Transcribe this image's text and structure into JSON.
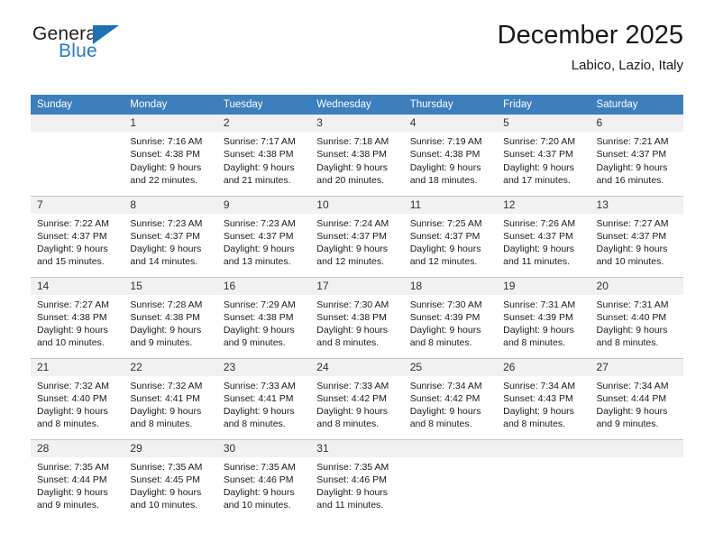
{
  "logo": {
    "name_top": "General",
    "name_bottom": "Blue",
    "flag_icon": "blue-flag-triangle",
    "color_blue": "#1f7ec4",
    "color_dark": "#231f20"
  },
  "header": {
    "title": "December 2025",
    "subtitle": "Labico, Lazio, Italy"
  },
  "theme": {
    "header_bar": "#3d7ebd",
    "daynum_band": "#f1f1f1",
    "grid_line": "#b9c8d6"
  },
  "weekday_headers": [
    "Sunday",
    "Monday",
    "Tuesday",
    "Wednesday",
    "Thursday",
    "Friday",
    "Saturday"
  ],
  "weeks": [
    [
      {
        "day": "",
        "lines": []
      },
      {
        "day": "1",
        "lines": [
          "Sunrise: 7:16 AM",
          "Sunset: 4:38 PM",
          "Daylight: 9 hours",
          "and 22 minutes."
        ]
      },
      {
        "day": "2",
        "lines": [
          "Sunrise: 7:17 AM",
          "Sunset: 4:38 PM",
          "Daylight: 9 hours",
          "and 21 minutes."
        ]
      },
      {
        "day": "3",
        "lines": [
          "Sunrise: 7:18 AM",
          "Sunset: 4:38 PM",
          "Daylight: 9 hours",
          "and 20 minutes."
        ]
      },
      {
        "day": "4",
        "lines": [
          "Sunrise: 7:19 AM",
          "Sunset: 4:38 PM",
          "Daylight: 9 hours",
          "and 18 minutes."
        ]
      },
      {
        "day": "5",
        "lines": [
          "Sunrise: 7:20 AM",
          "Sunset: 4:37 PM",
          "Daylight: 9 hours",
          "and 17 minutes."
        ]
      },
      {
        "day": "6",
        "lines": [
          "Sunrise: 7:21 AM",
          "Sunset: 4:37 PM",
          "Daylight: 9 hours",
          "and 16 minutes."
        ]
      }
    ],
    [
      {
        "day": "7",
        "lines": [
          "Sunrise: 7:22 AM",
          "Sunset: 4:37 PM",
          "Daylight: 9 hours",
          "and 15 minutes."
        ]
      },
      {
        "day": "8",
        "lines": [
          "Sunrise: 7:23 AM",
          "Sunset: 4:37 PM",
          "Daylight: 9 hours",
          "and 14 minutes."
        ]
      },
      {
        "day": "9",
        "lines": [
          "Sunrise: 7:23 AM",
          "Sunset: 4:37 PM",
          "Daylight: 9 hours",
          "and 13 minutes."
        ]
      },
      {
        "day": "10",
        "lines": [
          "Sunrise: 7:24 AM",
          "Sunset: 4:37 PM",
          "Daylight: 9 hours",
          "and 12 minutes."
        ]
      },
      {
        "day": "11",
        "lines": [
          "Sunrise: 7:25 AM",
          "Sunset: 4:37 PM",
          "Daylight: 9 hours",
          "and 12 minutes."
        ]
      },
      {
        "day": "12",
        "lines": [
          "Sunrise: 7:26 AM",
          "Sunset: 4:37 PM",
          "Daylight: 9 hours",
          "and 11 minutes."
        ]
      },
      {
        "day": "13",
        "lines": [
          "Sunrise: 7:27 AM",
          "Sunset: 4:37 PM",
          "Daylight: 9 hours",
          "and 10 minutes."
        ]
      }
    ],
    [
      {
        "day": "14",
        "lines": [
          "Sunrise: 7:27 AM",
          "Sunset: 4:38 PM",
          "Daylight: 9 hours",
          "and 10 minutes."
        ]
      },
      {
        "day": "15",
        "lines": [
          "Sunrise: 7:28 AM",
          "Sunset: 4:38 PM",
          "Daylight: 9 hours",
          "and 9 minutes."
        ]
      },
      {
        "day": "16",
        "lines": [
          "Sunrise: 7:29 AM",
          "Sunset: 4:38 PM",
          "Daylight: 9 hours",
          "and 9 minutes."
        ]
      },
      {
        "day": "17",
        "lines": [
          "Sunrise: 7:30 AM",
          "Sunset: 4:38 PM",
          "Daylight: 9 hours",
          "and 8 minutes."
        ]
      },
      {
        "day": "18",
        "lines": [
          "Sunrise: 7:30 AM",
          "Sunset: 4:39 PM",
          "Daylight: 9 hours",
          "and 8 minutes."
        ]
      },
      {
        "day": "19",
        "lines": [
          "Sunrise: 7:31 AM",
          "Sunset: 4:39 PM",
          "Daylight: 9 hours",
          "and 8 minutes."
        ]
      },
      {
        "day": "20",
        "lines": [
          "Sunrise: 7:31 AM",
          "Sunset: 4:40 PM",
          "Daylight: 9 hours",
          "and 8 minutes."
        ]
      }
    ],
    [
      {
        "day": "21",
        "lines": [
          "Sunrise: 7:32 AM",
          "Sunset: 4:40 PM",
          "Daylight: 9 hours",
          "and 8 minutes."
        ]
      },
      {
        "day": "22",
        "lines": [
          "Sunrise: 7:32 AM",
          "Sunset: 4:41 PM",
          "Daylight: 9 hours",
          "and 8 minutes."
        ]
      },
      {
        "day": "23",
        "lines": [
          "Sunrise: 7:33 AM",
          "Sunset: 4:41 PM",
          "Daylight: 9 hours",
          "and 8 minutes."
        ]
      },
      {
        "day": "24",
        "lines": [
          "Sunrise: 7:33 AM",
          "Sunset: 4:42 PM",
          "Daylight: 9 hours",
          "and 8 minutes."
        ]
      },
      {
        "day": "25",
        "lines": [
          "Sunrise: 7:34 AM",
          "Sunset: 4:42 PM",
          "Daylight: 9 hours",
          "and 8 minutes."
        ]
      },
      {
        "day": "26",
        "lines": [
          "Sunrise: 7:34 AM",
          "Sunset: 4:43 PM",
          "Daylight: 9 hours",
          "and 8 minutes."
        ]
      },
      {
        "day": "27",
        "lines": [
          "Sunrise: 7:34 AM",
          "Sunset: 4:44 PM",
          "Daylight: 9 hours",
          "and 9 minutes."
        ]
      }
    ],
    [
      {
        "day": "28",
        "lines": [
          "Sunrise: 7:35 AM",
          "Sunset: 4:44 PM",
          "Daylight: 9 hours",
          "and 9 minutes."
        ]
      },
      {
        "day": "29",
        "lines": [
          "Sunrise: 7:35 AM",
          "Sunset: 4:45 PM",
          "Daylight: 9 hours",
          "and 10 minutes."
        ]
      },
      {
        "day": "30",
        "lines": [
          "Sunrise: 7:35 AM",
          "Sunset: 4:46 PM",
          "Daylight: 9 hours",
          "and 10 minutes."
        ]
      },
      {
        "day": "31",
        "lines": [
          "Sunrise: 7:35 AM",
          "Sunset: 4:46 PM",
          "Daylight: 9 hours",
          "and 11 minutes."
        ]
      },
      {
        "day": "",
        "lines": []
      },
      {
        "day": "",
        "lines": []
      },
      {
        "day": "",
        "lines": []
      }
    ]
  ]
}
